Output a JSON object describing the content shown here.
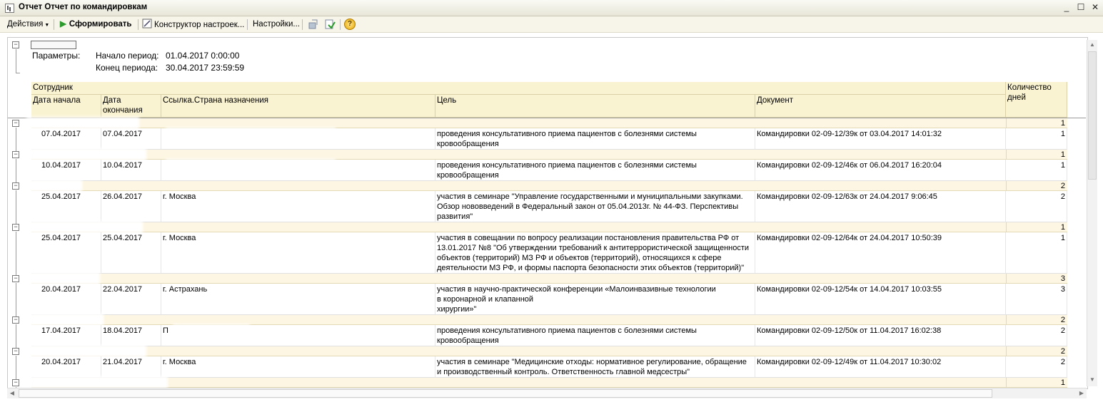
{
  "window": {
    "title": "Отчет  Отчет по командировкам",
    "min": "_",
    "max": "☐",
    "close": "✕"
  },
  "toolbar": {
    "actions_label": "Действия",
    "generate_label": "Сформировать",
    "constructor_label": "Конструктор настроек...",
    "settings_label": "Настройки...",
    "help_glyph": "?"
  },
  "params": {
    "label": "Параметры:",
    "start_label": "Начало период:",
    "start_value": "01.04.2017 0:00:00",
    "end_label": "Конец периода:",
    "end_value": "30.04.2017 23:59:59"
  },
  "headers": {
    "employee": "Сотрудник",
    "date_start": "Дата начала",
    "date_end": "Дата окончания",
    "country": "Ссылка.Страна назначения",
    "goal": "Цель",
    "document": "Документ",
    "days": "Количество дней"
  },
  "groups": [
    {
      "days": "1",
      "rows": [
        {
          "start": "07.04.2017",
          "end": "07.04.2017",
          "country": "",
          "goal": "проведения консультативного приема пациентов с болезнями системы кровообращения",
          "document": "Командировки 02-09-12/39к от 03.04.2017 14:01:32",
          "days": "1"
        }
      ]
    },
    {
      "days": "1",
      "rows": [
        {
          "start": "10.04.2017",
          "end": "10.04.2017",
          "country": "",
          "goal": "проведения консультативного приема пациентов с болезнями системы кровообращения",
          "document": "Командировки 02-09-12/46к от 06.04.2017 16:20:04",
          "days": "1"
        }
      ]
    },
    {
      "days": "2",
      "rows": [
        {
          "start": "25.04.2017",
          "end": "26.04.2017",
          "country": "г. Москва",
          "goal": "участия в семинаре \"Управление государственными и муниципальными закупками. Обзор нововведений в Федеральный закон от 05.04.2013г. № 44-ФЗ. Перспективы развития\"",
          "document": "Командировки 02-09-12/63к от 24.04.2017 9:06:45",
          "days": "2"
        }
      ]
    },
    {
      "days": "1",
      "rows": [
        {
          "start": "25.04.2017",
          "end": "25.04.2017",
          "country": "г. Москва",
          "goal": "участия в совещании по вопросу реализации постановления правительства РФ от 13.01.2017 №8 \"Об утверждении требований к антитеррористической защищенности объектов (территорий) МЗ РФ  и объектов (территорий), относящихся к сфере деятельности МЗ РФ, и формы паспорта безопасности этих объектов (территорий)\"",
          "document": "Командировки 02-09-12/64к от 24.04.2017 10:50:39",
          "days": "1"
        }
      ]
    },
    {
      "days": "3",
      "rows": [
        {
          "start": "20.04.2017",
          "end": "22.04.2017",
          "country": "г. Астрахань",
          "goal": "участия в научно-практической конференции «Малоинвазивные технологии\nв коронарной и клапанной\nхирургии»\"",
          "document": "Командировки 02-09-12/54к от 14.04.2017 10:03:55",
          "days": "3"
        }
      ]
    },
    {
      "days": "2",
      "rows": [
        {
          "start": "17.04.2017",
          "end": "18.04.2017",
          "country": "П",
          "goal": "проведения консультативного приема пациентов с болезнями системы кровообращения",
          "document": "Командировки 02-09-12/50к от 11.04.2017 16:02:38",
          "days": "2"
        }
      ]
    },
    {
      "days": "2",
      "rows": [
        {
          "start": "20.04.2017",
          "end": "21.04.2017",
          "country": "г. Москва",
          "goal": "участия в семинаре \"Медицинские отходы: нормативное регулирование, обращение и производственный контроль. Ответственность главной медсестры\"",
          "document": "Командировки 02-09-12/49к от 11.04.2017 10:30:02",
          "days": "2"
        }
      ]
    },
    {
      "days": "1",
      "rows": []
    }
  ]
}
